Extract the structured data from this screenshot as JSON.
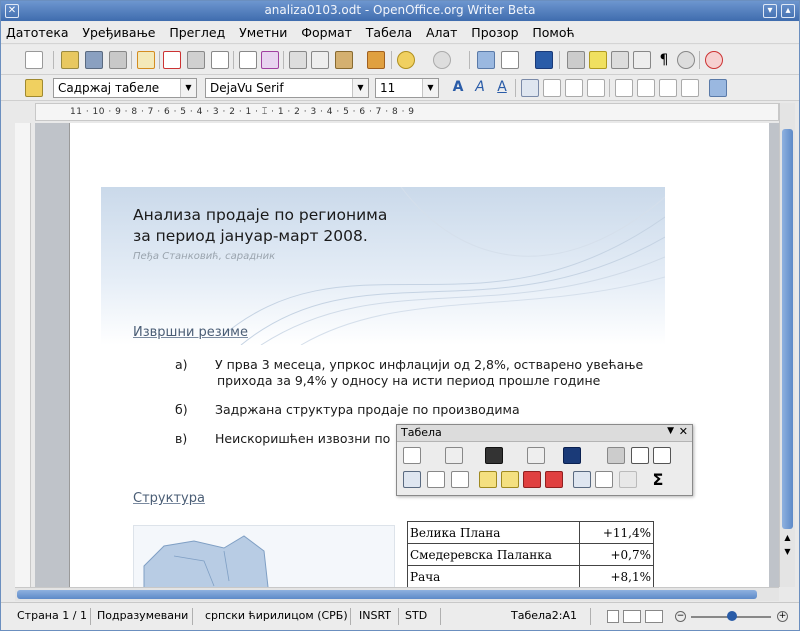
{
  "window": {
    "title": "analiza0103.odt - OpenOffice.org Writer Beta"
  },
  "menu": [
    "Датотека",
    "Уређивање",
    "Преглед",
    "Уметни",
    "Формат",
    "Табела",
    "Алат",
    "Прозор",
    "Помоћ"
  ],
  "formatting": {
    "style": "Садржај табеле",
    "font": "DejaVu Serif",
    "size": "11"
  },
  "ruler": {
    "text": "11 · 10 · 9 · 8 · 7 · 6 · 5 · 4 · 3 · 2 · 1 · ⌶ · 1 · 2 · 3 · 4 · 5 · 6 · 7 · 8 · 9"
  },
  "document": {
    "title_line1": "Анализа продаје по регионима",
    "title_line2": "за период јануар-март 2008.",
    "author": "Пеђа Станковић, сарадник",
    "section1": "Извршни резиме",
    "items": [
      {
        "marker": "а)",
        "line1": "У прва 3 месеца, упркос инфлацији од 2,8%, остварено увећање",
        "line2": "прихода за 9,4% у односу на исти период прошле године"
      },
      {
        "marker": "б)",
        "line1": "Задржана структура продаје по производима",
        "line2": ""
      },
      {
        "marker": "в)",
        "line1": "Неискоришћен извозни по",
        "line2": ""
      }
    ],
    "section2": "Структура",
    "table": [
      {
        "region": "Велика Плана",
        "value": "+11,4%"
      },
      {
        "region": "Смедеревска Паланка",
        "value": "+0,7%"
      },
      {
        "region": "Рача",
        "value": "+8,1%"
      }
    ]
  },
  "floating_toolbar": {
    "title": "Табела",
    "sum_symbol": "Σ"
  },
  "status": {
    "page": "Страна 1 / 1",
    "page_style": "Подразумевани",
    "language": "српски ћирилицом (СРБ)",
    "insert_mode": "INSRT",
    "selection_mode": "STD",
    "cell": "Табела2:А1"
  },
  "colors": {
    "titlebar": "#4f7cbd",
    "heading": "#4a5d75",
    "accent": "#3f6cae"
  }
}
